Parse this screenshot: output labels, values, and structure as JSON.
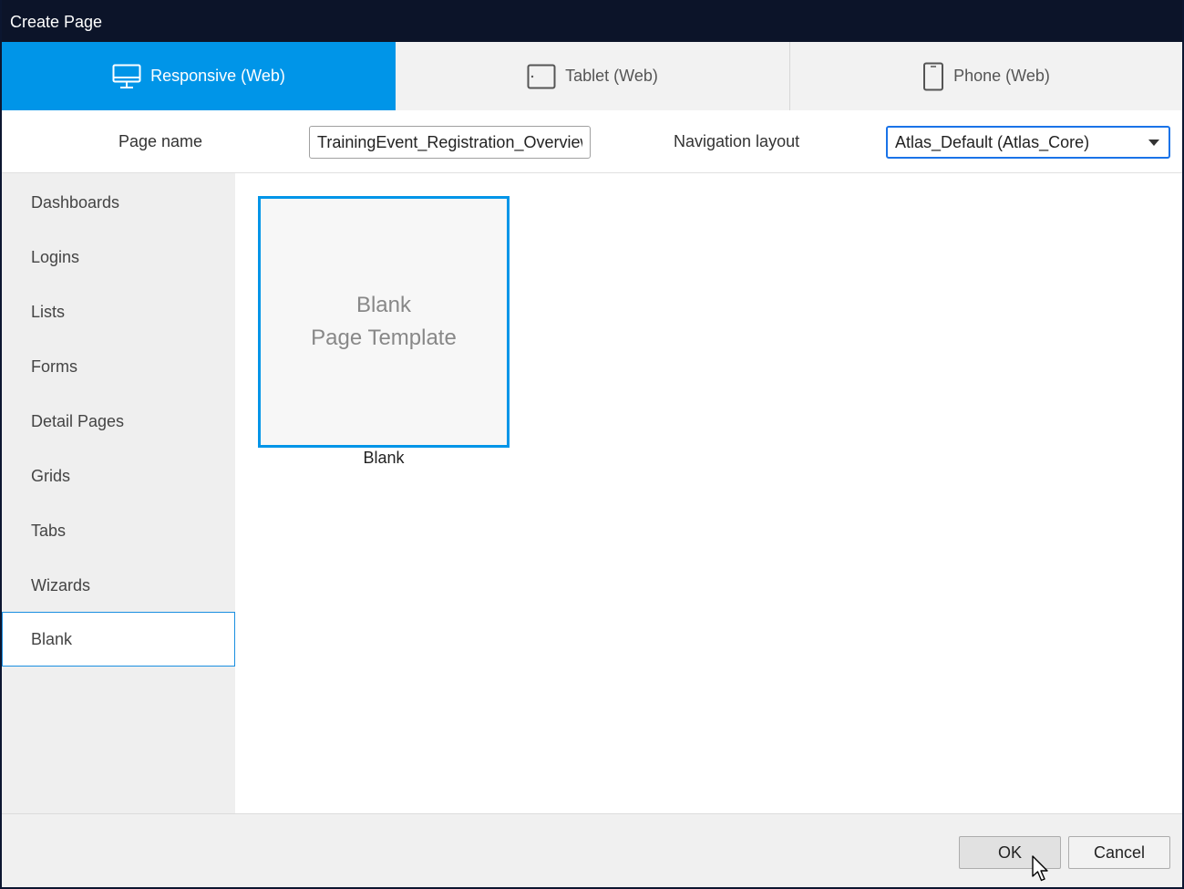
{
  "window": {
    "title": "Create Page"
  },
  "tabs": [
    {
      "label": "Responsive (Web)",
      "icon": "monitor-icon",
      "active": true
    },
    {
      "label": "Tablet (Web)",
      "icon": "tablet-icon",
      "active": false
    },
    {
      "label": "Phone (Web)",
      "icon": "phone-icon",
      "active": false
    }
  ],
  "form": {
    "page_name_label": "Page name",
    "page_name_value": "TrainingEvent_Registration_Overview",
    "nav_layout_label": "Navigation layout",
    "nav_layout_value": "Atlas_Default (Atlas_Core)"
  },
  "sidebar": {
    "items": [
      {
        "label": "Dashboards"
      },
      {
        "label": "Logins"
      },
      {
        "label": "Lists"
      },
      {
        "label": "Forms"
      },
      {
        "label": "Detail Pages"
      },
      {
        "label": "Grids"
      },
      {
        "label": "Tabs"
      },
      {
        "label": "Wizards"
      },
      {
        "label": "Blank",
        "selected": true
      }
    ]
  },
  "templates": [
    {
      "preview_line1": "Blank",
      "preview_line2": "Page Template",
      "caption": "Blank",
      "selected": true
    }
  ],
  "footer": {
    "ok_label": "OK",
    "cancel_label": "Cancel"
  },
  "colors": {
    "accent": "#0095e8",
    "titlebar": "#0c1429",
    "selection_border": "#1a8fe0"
  }
}
